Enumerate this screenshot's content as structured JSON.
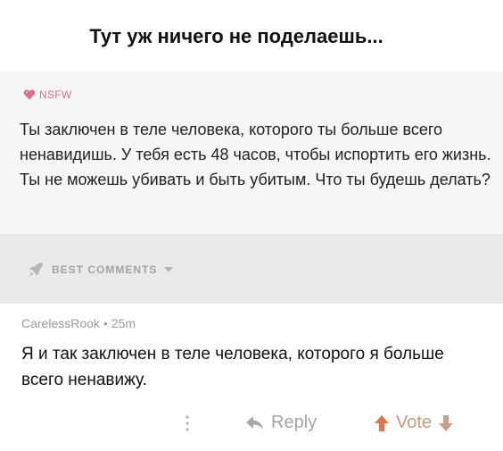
{
  "caption": "Тут уж ничего не поделаешь...",
  "post": {
    "nsfw_label": "NSFW",
    "question": "Ты заключен в теле человека, которого ты больше всего ненавидишь. У тебя есть 48 часов, чтобы испортить его жизнь. Ты не можешь убивать и быть убитым. Что ты будешь делать?"
  },
  "comments_section": {
    "sort_label": "BEST COMMENTS"
  },
  "comment": {
    "author": "CarelessRook",
    "separator": "•",
    "age": "25m",
    "text": "Я и так заключен в теле человека, которого я больше всего ненавижу."
  },
  "actions": {
    "reply_label": "Reply",
    "vote_label": "Vote"
  },
  "icons": {
    "nsfw": "heart-icon",
    "best": "rocket-icon",
    "sort": "chevron-down-icon",
    "more": "more-vertical-icon",
    "reply": "reply-arrow-icon",
    "upvote": "upvote-arrow-icon",
    "downvote": "downvote-arrow-icon"
  },
  "colors": {
    "nsfw": "#e46b89",
    "muted_text": "#a5a5a5",
    "upvote": "#e8734a",
    "downvote": "#c9a189",
    "post_background": "#f6f6f6",
    "divider_background": "#eaeaea"
  }
}
